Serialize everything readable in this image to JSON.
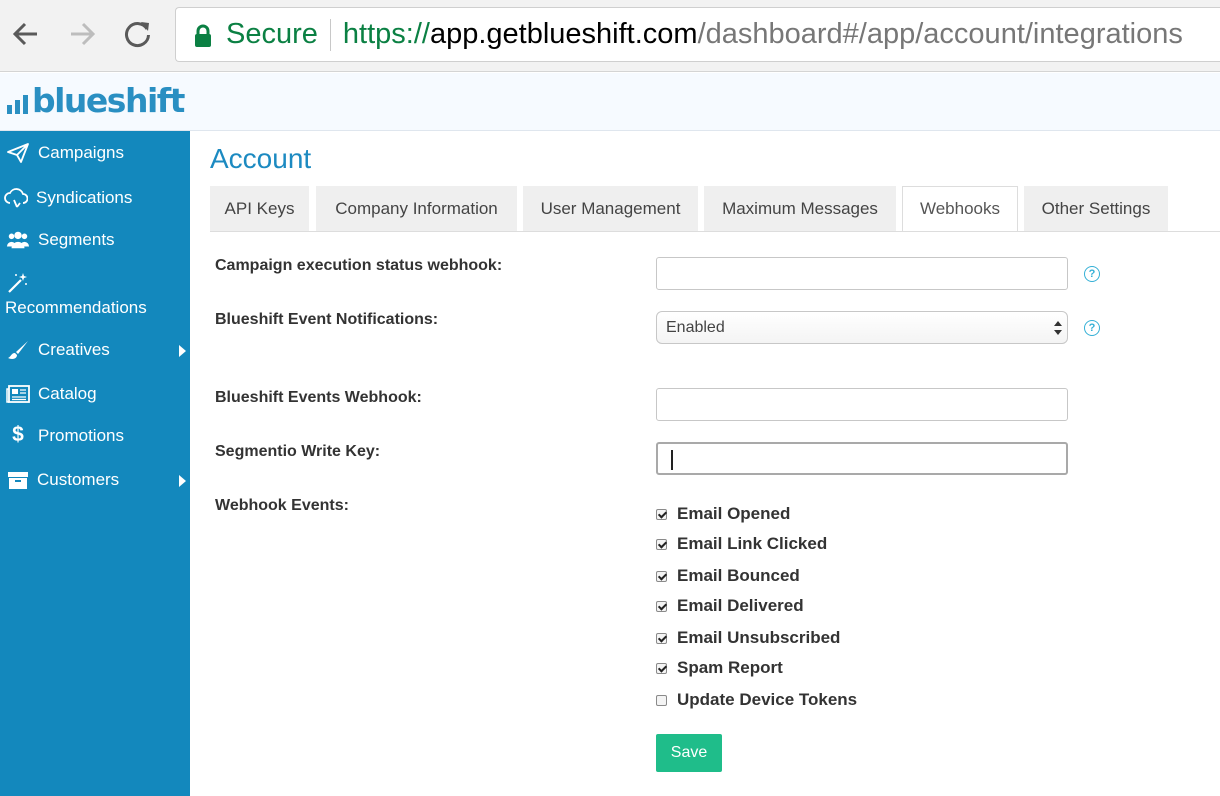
{
  "browser": {
    "secure_label": "Secure",
    "url_scheme": "https://",
    "url_host": "app.getblueshift.com",
    "url_path": "/dashboard#/app/account/integrations"
  },
  "app": {
    "logo_text": "blueshift",
    "brand_color": "#1388bd"
  },
  "sidebar": {
    "items": [
      {
        "label": "Campaigns",
        "icon": "paper-plane-icon",
        "submenu": false
      },
      {
        "label": "Syndications",
        "icon": "cloud-sync-icon",
        "submenu": false
      },
      {
        "label": "Segments",
        "icon": "users-icon",
        "submenu": false
      },
      {
        "label": "Recommendations",
        "icon": "magic-wand-icon",
        "submenu": false
      },
      {
        "label": "Creatives",
        "icon": "paintbrush-icon",
        "submenu": true
      },
      {
        "label": "Catalog",
        "icon": "newspaper-icon",
        "submenu": false
      },
      {
        "label": "Promotions",
        "icon": "dollar-icon",
        "submenu": false
      },
      {
        "label": "Customers",
        "icon": "archive-box-icon",
        "submenu": true
      }
    ]
  },
  "page": {
    "title": "Account",
    "tabs": [
      {
        "label": "API Keys",
        "active": false
      },
      {
        "label": "Company Information",
        "active": false
      },
      {
        "label": "User Management",
        "active": false
      },
      {
        "label": "Maximum Messages",
        "active": false
      },
      {
        "label": "Webhooks",
        "active": true
      },
      {
        "label": "Other Settings",
        "active": false
      }
    ]
  },
  "form": {
    "campaign_webhook": {
      "label": "Campaign execution status webhook:",
      "value": ""
    },
    "event_notifications": {
      "label": "Blueshift Event Notifications:",
      "value": "Enabled"
    },
    "events_webhook": {
      "label": "Blueshift Events Webhook:",
      "value": ""
    },
    "segmentio_key": {
      "label": "Segmentio Write Key:",
      "value": ""
    },
    "webhook_events_label": "Webhook Events:",
    "help_glyph": "?",
    "events": [
      {
        "label": "Email Opened",
        "checked": true
      },
      {
        "label": "Email Link Clicked",
        "checked": true
      },
      {
        "label": "Email Bounced",
        "checked": true
      },
      {
        "label": "Email Delivered",
        "checked": true
      },
      {
        "label": "Email Unsubscribed",
        "checked": true
      },
      {
        "label": "Spam Report",
        "checked": true
      },
      {
        "label": "Update Device Tokens",
        "checked": false
      }
    ],
    "save_label": "Save"
  }
}
